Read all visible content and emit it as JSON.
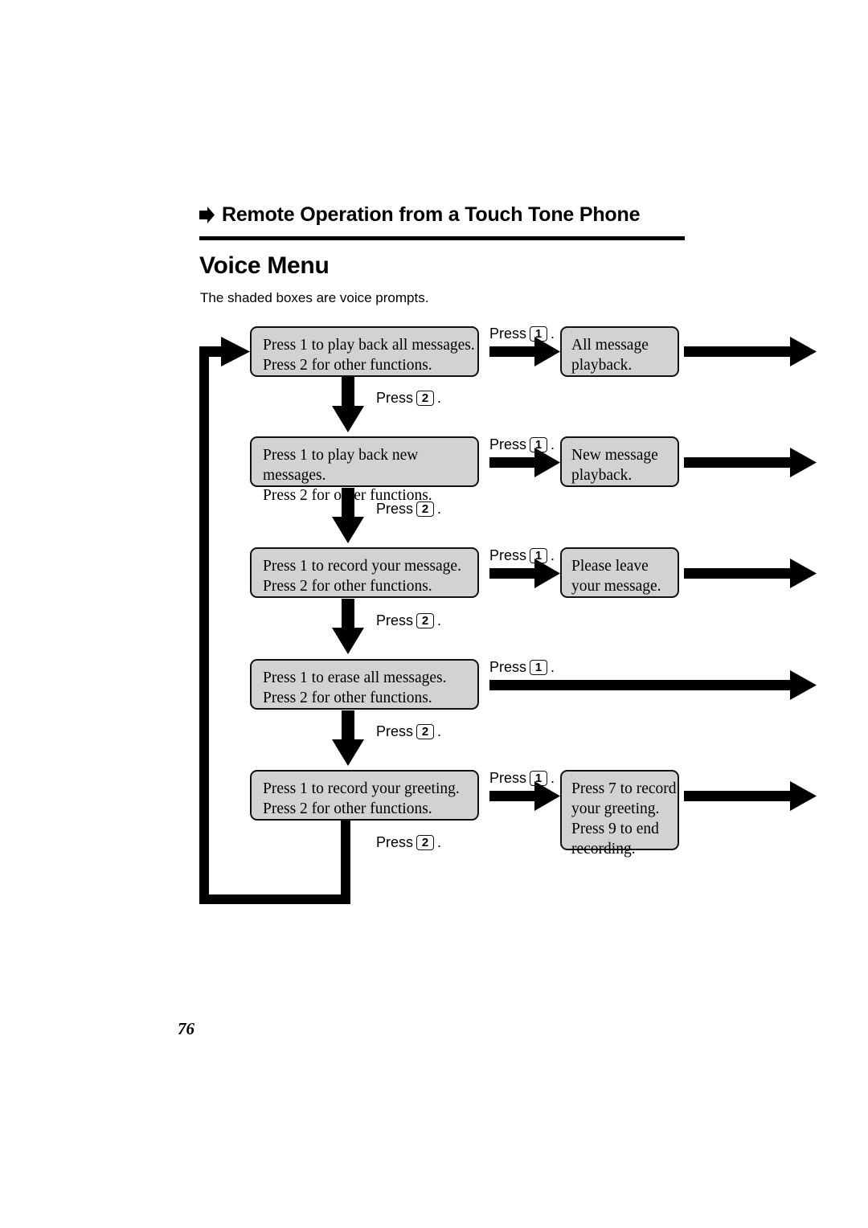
{
  "header": {
    "bullet_icon": "right-arrow-bullet-icon",
    "section_title": "Remote Operation from a Touch Tone Phone",
    "page_heading": "Voice Menu",
    "intro": "The shaded boxes are voice prompts."
  },
  "labels": {
    "press_word": "Press",
    "key_1": "1",
    "key_2": "2",
    "period": "."
  },
  "flow": {
    "rows": [
      {
        "menu_line1": "Press 1 to play back all messages.",
        "menu_line2": "Press 2 for other functions.",
        "prompt_lines": [
          "All message",
          "playback."
        ]
      },
      {
        "menu_line1": "Press 1 to play back new messages.",
        "menu_line2": "Press 2 for other functions.",
        "prompt_lines": [
          "New message",
          "playback."
        ]
      },
      {
        "menu_line1": "Press 1 to record your message.",
        "menu_line2": "Press 2 for other functions.",
        "prompt_lines": [
          "Please leave",
          "your message."
        ]
      },
      {
        "menu_line1": "Press 1 to erase all messages.",
        "menu_line2": "Press 2 for other functions.",
        "prompt_lines": []
      },
      {
        "menu_line1": "Press 1 to record your greeting.",
        "menu_line2": "Press 2 for other functions.",
        "prompt_lines": [
          "Press 7 to record",
          "your greeting.",
          "Press 9 to end",
          "recording."
        ]
      }
    ]
  },
  "footer": {
    "page_number": "76"
  },
  "colors": {
    "box_fill": "#d2d2d2",
    "box_border": "#111111",
    "ink": "#000000",
    "background": "#ffffff"
  }
}
